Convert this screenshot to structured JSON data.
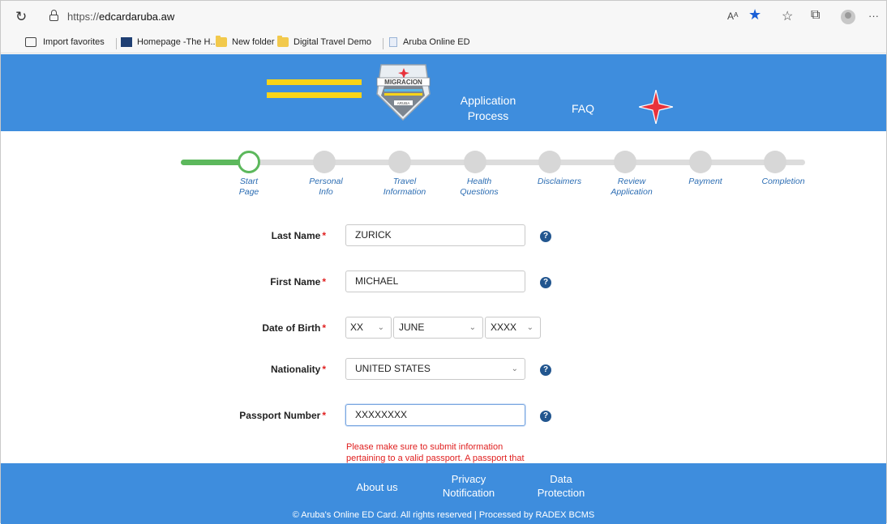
{
  "browser": {
    "url_prefix": "https://",
    "url_host": "edcardaruba.aw",
    "read_aloud_label": "Aᴬ",
    "menu_label": "···"
  },
  "favorites": [
    {
      "label": "Import favorites",
      "icon": "import-icon"
    },
    {
      "label": "Homepage -The H...",
      "icon": "site-favicon"
    },
    {
      "label": "New folder",
      "icon": "folder-icon"
    },
    {
      "label": "Digital Travel Demo",
      "icon": "folder-icon"
    },
    {
      "label": "Aruba Online ED",
      "icon": "page-icon"
    }
  ],
  "header": {
    "badge_text": "MIGRACION",
    "badge_sub": "ARUBA",
    "nav_application": "Application Process",
    "nav_faq": "FAQ",
    "colors": {
      "header_bg": "#3e8ddd",
      "accent_yellow": "#f8d418",
      "accent_red": "#e8323c"
    }
  },
  "steps": [
    {
      "label": "Start Page",
      "state": "current"
    },
    {
      "label": "Personal Info",
      "state": "pending"
    },
    {
      "label": "Travel Information",
      "state": "pending"
    },
    {
      "label": "Health Questions",
      "state": "pending"
    },
    {
      "label": "Disclaimers",
      "state": "pending"
    },
    {
      "label": "Review Application",
      "state": "pending"
    },
    {
      "label": "Payment",
      "state": "pending"
    },
    {
      "label": "Completion",
      "state": "pending"
    }
  ],
  "form": {
    "last_name": {
      "label": "Last Name",
      "value": "ZURICK"
    },
    "first_name": {
      "label": "First Name",
      "value": "MICHAEL"
    },
    "dob": {
      "label": "Date of Birth",
      "day": "XX",
      "month": "JUNE",
      "year": "XXXX"
    },
    "nationality": {
      "label": "Nationality",
      "value": "UNITED STATES"
    },
    "passport": {
      "label": "Passport Number",
      "value": "XXXXXXXX"
    },
    "required_mark": "*",
    "help_mark": "?",
    "warning_line1": "Please make sure to submit information",
    "warning_line2": "pertaining to a valid passport. A passport that"
  },
  "footer": {
    "about": "About us",
    "privacy": "Privacy Notification",
    "data_protection": "Data Protection",
    "copyright": "©  Aruba's Online ED Card. All rights reserved | Processed by RADEX BCMS"
  }
}
